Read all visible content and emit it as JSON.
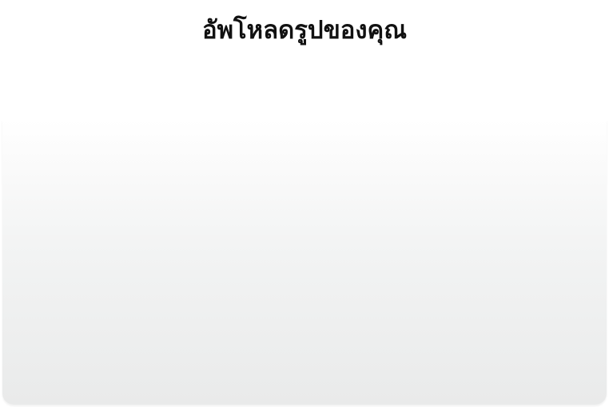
{
  "page": {
    "title": "อัพโหลดรูปของคุณ"
  }
}
